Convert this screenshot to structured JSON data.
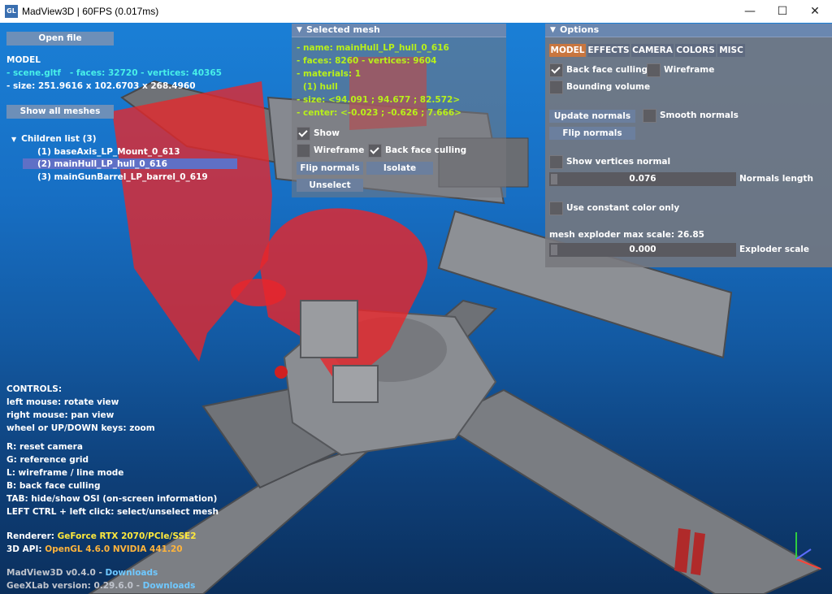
{
  "window": {
    "app_icon_text": "GL",
    "title": "MadView3D | 60FPS (0.017ms)",
    "minimize_glyph": "—",
    "maximize_glyph": "☐",
    "close_glyph": "✕"
  },
  "left_panel": {
    "open_file_label": "Open file",
    "model_heading": "MODEL",
    "file_name": "- scene.gltf",
    "faces_vertices": "- faces: 32720 - vertices: 40365",
    "size": "- size:  251.9616 x 102.6703 x 268.4960",
    "show_all_meshes_label": "Show all meshes",
    "children_heading": "Children list (3)",
    "children": [
      {
        "label": "(1) baseAxis_LP_Mount_0_613",
        "selected": false
      },
      {
        "label": "(2) mainHull_LP_hull_0_616",
        "selected": true
      },
      {
        "label": "(3) mainGunBarrel_LP_barrel_0_619",
        "selected": false
      }
    ]
  },
  "controls": {
    "heading": "CONTROLS:",
    "mouse_lines": [
      "left mouse: rotate view",
      "right mouse: pan view",
      "wheel or UP/DOWN keys: zoom"
    ],
    "key_lines": [
      "R: reset camera",
      "G: reference grid",
      "L: wireframe / line mode",
      "B: back face culling",
      "TAB: hide/show OSI (on-screen information)",
      "LEFT CTRL + left click: select/unselect mesh"
    ],
    "renderer_label": "Renderer:",
    "renderer_value": "GeForce RTX 2070/PCIe/SSE2",
    "api_label": "3D API:",
    "api_value": "OpenGL 4.6.0 NVIDIA 441.20",
    "version_text": "MadView3D v0.4.0 -",
    "version_link": "Downloads",
    "geex_text": "GeeXLab version: 0.29.6.0 -",
    "geex_link": "Downloads"
  },
  "selected_mesh": {
    "title": "Selected mesh",
    "name": "- name: mainHull_LP_hull_0_616",
    "faces": "- faces: 8260 - vertices: 9604",
    "materials": "- materials: 1",
    "material_item": "(1) hull",
    "size": "- size: <94.091 ; 94.677 ; 82.572>",
    "center": "- center: <-0.023 ; -0.626 ; 7.666>",
    "show_label": "Show",
    "show_checked": true,
    "wireframe_label": "Wireframe",
    "wireframe_checked": false,
    "backface_label": "Back face culling",
    "backface_checked": true,
    "flip_normals_label": "Flip normals",
    "isolate_label": "Isolate",
    "unselect_label": "Unselect"
  },
  "options": {
    "title": "Options",
    "tabs": [
      {
        "label": "MODEL",
        "active": true
      },
      {
        "label": "EFFECTS",
        "active": false
      },
      {
        "label": "CAMERA",
        "active": false
      },
      {
        "label": "COLORS",
        "active": false
      },
      {
        "label": "MISC",
        "active": false
      }
    ],
    "backface_label": "Back face culling",
    "backface_checked": true,
    "wireframe_label": "Wireframe",
    "wireframe_checked": false,
    "bounding_label": "Bounding volume",
    "bounding_checked": false,
    "update_normals_label": "Update normals",
    "smooth_normals_label": "Smooth normals",
    "smooth_checked": false,
    "flip_normals_label": "Flip normals",
    "show_vertices_normal_label": "Show vertices normal",
    "show_vertices_checked": false,
    "normals_length_value": "0.076",
    "normals_length_label": "Normals length",
    "constant_color_label": "Use constant color only",
    "constant_color_checked": false,
    "exploder_heading": "mesh exploder max scale: 26.85",
    "exploder_value": "0.000",
    "exploder_label": "Exploder scale"
  },
  "colors": {
    "viewport_top": "#1a7fd6",
    "viewport_bottom": "#0b2f5c",
    "highlight_red": "#e8262a",
    "hud_yellow": "#ffe93c",
    "hud_green": "#b8f01a",
    "link_blue": "#6fc8ff",
    "active_tab": "#c8763f"
  }
}
